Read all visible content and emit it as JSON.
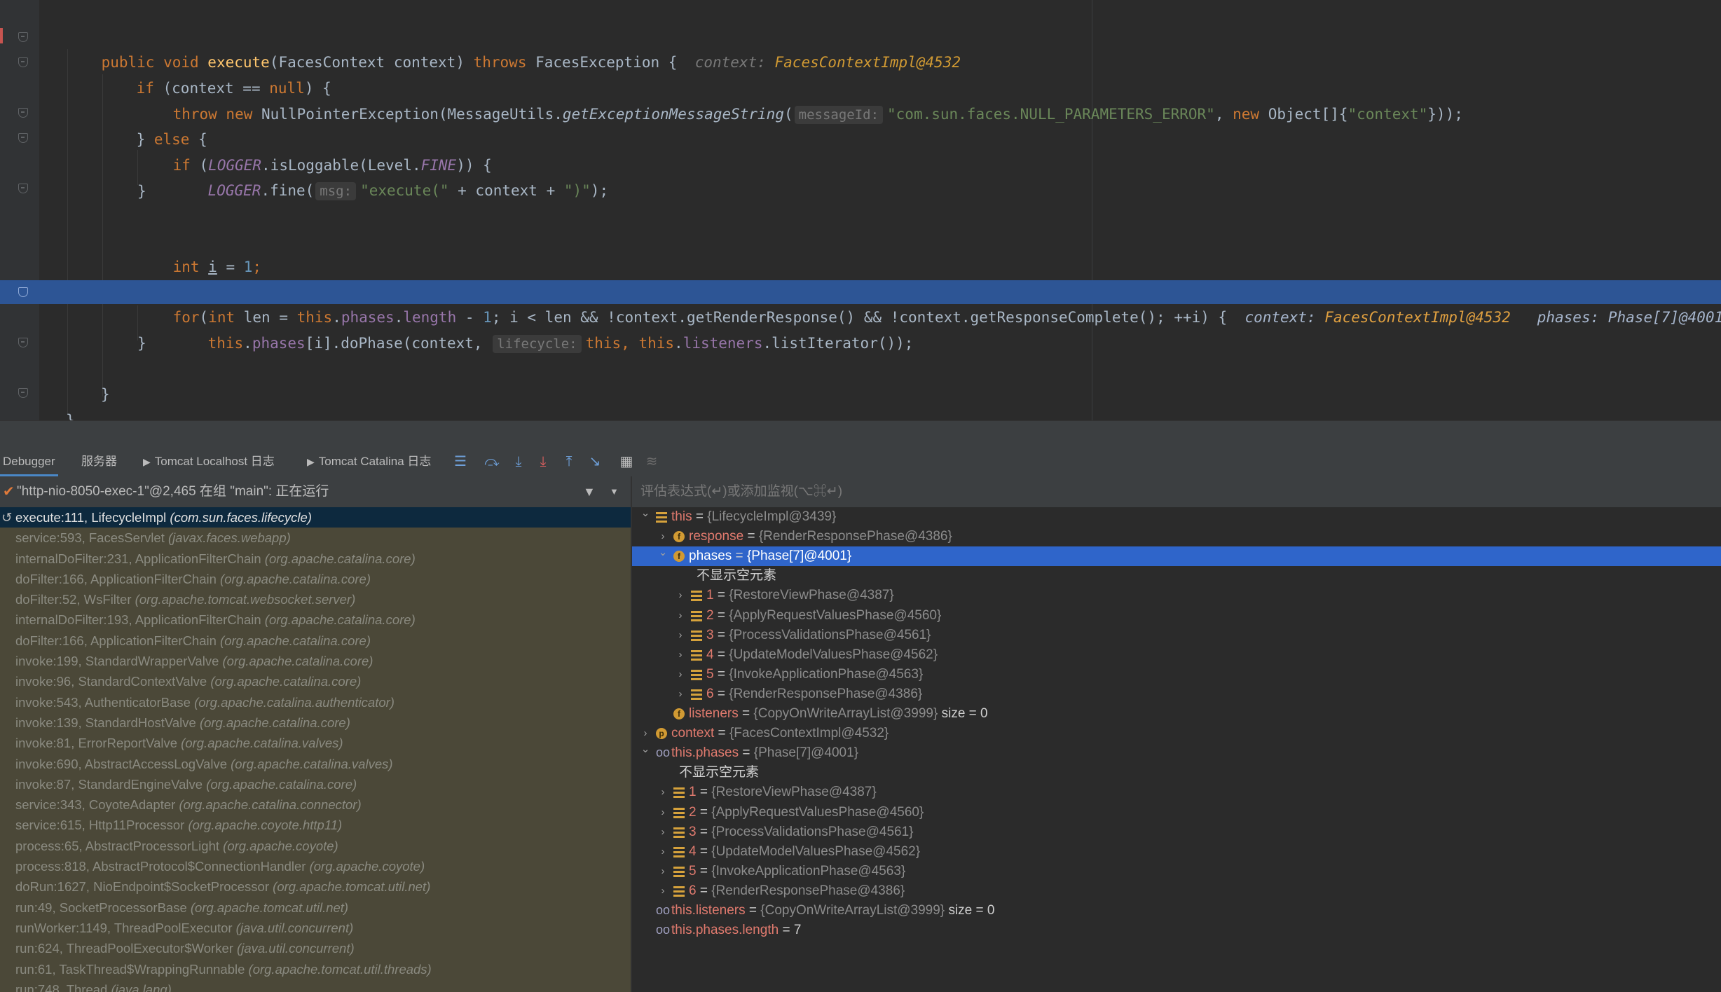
{
  "editor": {
    "lines": {
      "l1": {
        "sig": "public void ",
        "method": "execute",
        "params": "(FacesContext context) ",
        "throws": "throws ",
        "exc": "FacesException {",
        "inlay_name": "context: ",
        "inlay_val": "FacesContextImpl@4532"
      },
      "l2": {
        "if_kw": "if ",
        "cond": "(context == ",
        "null_kw": "null",
        "tail": ") {"
      },
      "l3": {
        "throw_kw": "throw new ",
        "cls": "NullPointerException(MessageUtils.",
        "call": "getExceptionMessageString",
        "paren": "(",
        "hint": "messageId:",
        "str": "\"com.sun.faces.NULL_PARAMETERS_ERROR\"",
        "comma": ", ",
        "new_kw": "new ",
        "tail1": "Object[]{",
        "str2": "\"context\"",
        "tail2": "}));"
      },
      "l4": {
        "close": "} ",
        "else_kw": "else",
        "tail": " {"
      },
      "l5": {
        "if_kw": "if ",
        "open": "(",
        "logger": "LOGGER",
        "mid": ".isLoggable(Level.",
        "fine": "FINE",
        "tail": ")) {"
      },
      "l6": {
        "logger": "LOGGER",
        "call": ".fine(",
        "hint": "msg:",
        "str1": "\"execute(\"",
        "mid": " + context + ",
        "str2": "\")\"",
        "tail": ");"
      },
      "l7": {
        "text": "}"
      },
      "l8": {
        "int_kw": "int ",
        "var": "i",
        "eq": " = ",
        "num": "1",
        "semi": ";"
      },
      "l9": {
        "for_kw": "for",
        "open": "(",
        "int_kw": "int ",
        "a": "len = ",
        "this1": "this",
        "dot1": ".",
        "phases": "phases",
        "dot2": ".",
        "length": "length",
        "minus": " - ",
        "num": "1",
        "b": "; i < len && !context.getRenderResponse() && !context.getResponseComplete(); ++i) {",
        "inlay1_name": "context: ",
        "inlay1_val": "FacesContextImpl@4532",
        "inlay2": "phases: Phase[7]@4001"
      },
      "l10": {
        "this1": "this",
        "dot": ".",
        "phases": "phases",
        "a": "[i].doPhase(context, ",
        "hint": "lifecycle:",
        "this2": "this",
        "comma": ", ",
        "this3": "this",
        "dot2": ".",
        "listeners": "listeners",
        "b": ".listIterator());"
      },
      "l11": {
        "text": "}"
      },
      "l12": {
        "text": "}"
      },
      "l13": {
        "text": "}"
      }
    }
  },
  "toolbar": {
    "tab_debugger": "Debugger",
    "tab_server": "服务器",
    "tab_tomcat_localhost": "Tomcat Localhost 日志",
    "tab_tomcat_catalina": "Tomcat Catalina 日志",
    "icons": [
      "threads-icon",
      "step-over-icon",
      "step-into-icon",
      "force-step-into-icon",
      "step-out-icon",
      "run-to-cursor-icon",
      "evaluate-icon",
      "trace-icon"
    ]
  },
  "thread": {
    "label": "\"http-nio-8050-exec-1\"@2,465 在组 \"main\": 正在运行"
  },
  "frames": [
    {
      "method": "execute:111, LifecycleImpl ",
      "pkg": "(com.sun.faces.lifecycle)"
    },
    {
      "method": "service:593, FacesServlet ",
      "pkg": "(javax.faces.webapp)"
    },
    {
      "method": "internalDoFilter:231, ApplicationFilterChain ",
      "pkg": "(org.apache.catalina.core)"
    },
    {
      "method": "doFilter:166, ApplicationFilterChain ",
      "pkg": "(org.apache.catalina.core)"
    },
    {
      "method": "doFilter:52, WsFilter ",
      "pkg": "(org.apache.tomcat.websocket.server)"
    },
    {
      "method": "internalDoFilter:193, ApplicationFilterChain ",
      "pkg": "(org.apache.catalina.core)"
    },
    {
      "method": "doFilter:166, ApplicationFilterChain ",
      "pkg": "(org.apache.catalina.core)"
    },
    {
      "method": "invoke:199, StandardWrapperValve ",
      "pkg": "(org.apache.catalina.core)"
    },
    {
      "method": "invoke:96, StandardContextValve ",
      "pkg": "(org.apache.catalina.core)"
    },
    {
      "method": "invoke:543, AuthenticatorBase ",
      "pkg": "(org.apache.catalina.authenticator)"
    },
    {
      "method": "invoke:139, StandardHostValve ",
      "pkg": "(org.apache.catalina.core)"
    },
    {
      "method": "invoke:81, ErrorReportValve ",
      "pkg": "(org.apache.catalina.valves)"
    },
    {
      "method": "invoke:690, AbstractAccessLogValve ",
      "pkg": "(org.apache.catalina.valves)"
    },
    {
      "method": "invoke:87, StandardEngineValve ",
      "pkg": "(org.apache.catalina.core)"
    },
    {
      "method": "service:343, CoyoteAdapter ",
      "pkg": "(org.apache.catalina.connector)"
    },
    {
      "method": "service:615, Http11Processor ",
      "pkg": "(org.apache.coyote.http11)"
    },
    {
      "method": "process:65, AbstractProcessorLight ",
      "pkg": "(org.apache.coyote)"
    },
    {
      "method": "process:818, AbstractProtocol$ConnectionHandler ",
      "pkg": "(org.apache.coyote)"
    },
    {
      "method": "doRun:1627, NioEndpoint$SocketProcessor ",
      "pkg": "(org.apache.tomcat.util.net)"
    },
    {
      "method": "run:49, SocketProcessorBase ",
      "pkg": "(org.apache.tomcat.util.net)"
    },
    {
      "method": "runWorker:1149, ThreadPoolExecutor ",
      "pkg": "(java.util.concurrent)"
    },
    {
      "method": "run:624, ThreadPoolExecutor$Worker ",
      "pkg": "(java.util.concurrent)"
    },
    {
      "method": "run:61, TaskThread$WrappingRunnable ",
      "pkg": "(org.apache.tomcat.util.threads)"
    },
    {
      "method": "run:748, Thread ",
      "pkg": "(java.lang)"
    }
  ],
  "variables": {
    "watch_placeholder": "评估表达式(↵)或添加监视(⌥⌘↵)",
    "rows": [
      {
        "indent": 0,
        "arrow": "open",
        "icon": "list",
        "name": "this",
        "eq": " = ",
        "val": "{LifecycleImpl@3439}",
        "extra": ""
      },
      {
        "indent": 1,
        "arrow": "closed",
        "icon": "field",
        "name": "response",
        "eq": " = ",
        "val": "{RenderResponsePhase@4386}",
        "extra": ""
      },
      {
        "indent": 1,
        "arrow": "open",
        "icon": "field",
        "name": "phases",
        "eq": " = ",
        "val": "{Phase[7]@4001}",
        "extra": "",
        "selected": true
      },
      {
        "indent": 2,
        "arrow": "none",
        "icon": "none",
        "name": "",
        "eq": "",
        "val": "",
        "extra": "不显示空元素"
      },
      {
        "indent": 2,
        "arrow": "closed",
        "icon": "list",
        "name": "1",
        "eq": " = ",
        "val": "{RestoreViewPhase@4387}",
        "extra": ""
      },
      {
        "indent": 2,
        "arrow": "closed",
        "icon": "list",
        "name": "2",
        "eq": " = ",
        "val": "{ApplyRequestValuesPhase@4560}",
        "extra": ""
      },
      {
        "indent": 2,
        "arrow": "closed",
        "icon": "list",
        "name": "3",
        "eq": " = ",
        "val": "{ProcessValidationsPhase@4561}",
        "extra": ""
      },
      {
        "indent": 2,
        "arrow": "closed",
        "icon": "list",
        "name": "4",
        "eq": " = ",
        "val": "{UpdateModelValuesPhase@4562}",
        "extra": ""
      },
      {
        "indent": 2,
        "arrow": "closed",
        "icon": "list",
        "name": "5",
        "eq": " = ",
        "val": "{InvokeApplicationPhase@4563}",
        "extra": ""
      },
      {
        "indent": 2,
        "arrow": "closed",
        "icon": "list",
        "name": "6",
        "eq": " = ",
        "val": "{RenderResponsePhase@4386}",
        "extra": ""
      },
      {
        "indent": 1,
        "arrow": "none",
        "icon": "field",
        "name": "listeners",
        "eq": " = ",
        "val": "{CopyOnWriteArrayList@3999}",
        "extra": " size = 0"
      },
      {
        "indent": 0,
        "arrow": "closed",
        "icon": "param",
        "name": "context",
        "eq": " = ",
        "val": "{FacesContextImpl@4532}",
        "extra": ""
      },
      {
        "indent": 0,
        "arrow": "open",
        "icon": "watch",
        "name": "this.phases",
        "eq": " = ",
        "val": "{Phase[7]@4001}",
        "extra": ""
      },
      {
        "indent": 1,
        "arrow": "none",
        "icon": "none",
        "name": "",
        "eq": "",
        "val": "",
        "extra": "不显示空元素"
      },
      {
        "indent": 1,
        "arrow": "closed",
        "icon": "list",
        "name": "1",
        "eq": " = ",
        "val": "{RestoreViewPhase@4387}",
        "extra": ""
      },
      {
        "indent": 1,
        "arrow": "closed",
        "icon": "list",
        "name": "2",
        "eq": " = ",
        "val": "{ApplyRequestValuesPhase@4560}",
        "extra": ""
      },
      {
        "indent": 1,
        "arrow": "closed",
        "icon": "list",
        "name": "3",
        "eq": " = ",
        "val": "{ProcessValidationsPhase@4561}",
        "extra": ""
      },
      {
        "indent": 1,
        "arrow": "closed",
        "icon": "list",
        "name": "4",
        "eq": " = ",
        "val": "{UpdateModelValuesPhase@4562}",
        "extra": ""
      },
      {
        "indent": 1,
        "arrow": "closed",
        "icon": "list",
        "name": "5",
        "eq": " = ",
        "val": "{InvokeApplicationPhase@4563}",
        "extra": ""
      },
      {
        "indent": 1,
        "arrow": "closed",
        "icon": "list",
        "name": "6",
        "eq": " = ",
        "val": "{RenderResponsePhase@4386}",
        "extra": ""
      },
      {
        "indent": 0,
        "arrow": "none",
        "icon": "watch",
        "name": "this.listeners",
        "eq": " = ",
        "val": "{CopyOnWriteArrayList@3999}",
        "extra": " size = 0"
      },
      {
        "indent": 0,
        "arrow": "none",
        "icon": "watch",
        "name": "this.phases.length",
        "eq": " = ",
        "val": "7",
        "extra": ""
      }
    ]
  },
  "colors": {
    "selected_row": "#2f65ca",
    "exec_line": "#2d5595",
    "frames_bg": "#4b4838"
  }
}
